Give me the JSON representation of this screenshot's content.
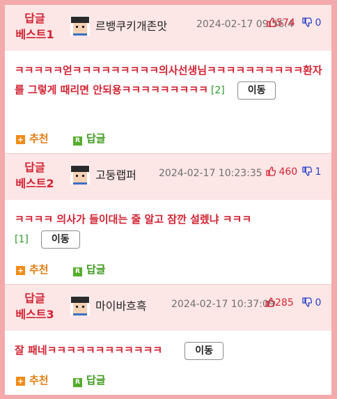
{
  "replies": [
    {
      "rank_line1": "답글",
      "rank_line2": "베스트1",
      "nick": "르뱅쿠키개존맛",
      "date": "2024-02-17 09:56:4",
      "up": "574",
      "down": "0",
      "text": "ㅋㅋㅋㅋㅋ얻ㅋㅋㅋㅋㅋㅋㅋㅋㅋ의사선생님ㅋㅋㅋㅋㅋㅋㅋㅋㅋㅋ환자를 그렇게 때리면 안되용ㅋㅋㅋㅋㅋㅋㅋㅋㅋ",
      "count": "[2]",
      "move": "이동",
      "recommend": "추천",
      "reply": "답글"
    },
    {
      "rank_line1": "답글",
      "rank_line2": "베스트2",
      "nick": "고둥랩퍼",
      "date": "2024-02-17 10:23:35",
      "up": "460",
      "down": "1",
      "text": "ㅋㅋㅋㅋ 의사가 들이대는 줄 알고 잠깐 설렜냐 ㅋㅋㅋ",
      "count": "[1]",
      "move": "이동",
      "recommend": "추천",
      "reply": "답글"
    },
    {
      "rank_line1": "답글",
      "rank_line2": "베스트3",
      "nick": "마이바흐흑",
      "date": "2024-02-17 10:37:09",
      "up": "285",
      "down": "0",
      "text": "잘 패네ㅋㅋㅋㅋㅋㅋㅋㅋㅋㅋㅋㅋ",
      "count": "",
      "move": "이동",
      "recommend": "추천",
      "reply": "답글"
    }
  ],
  "icons": {
    "up": "thumbs-up-icon",
    "down": "thumbs-down-icon",
    "recommend": "plus-icon",
    "reply": "r-icon"
  },
  "colors": {
    "accent": "#d22333",
    "downvote": "#2240c8",
    "recommend": "#e07d12",
    "reply": "#3d9a1c",
    "header_bg": "#fde6e6",
    "page_bg": "#f4a9aa"
  }
}
